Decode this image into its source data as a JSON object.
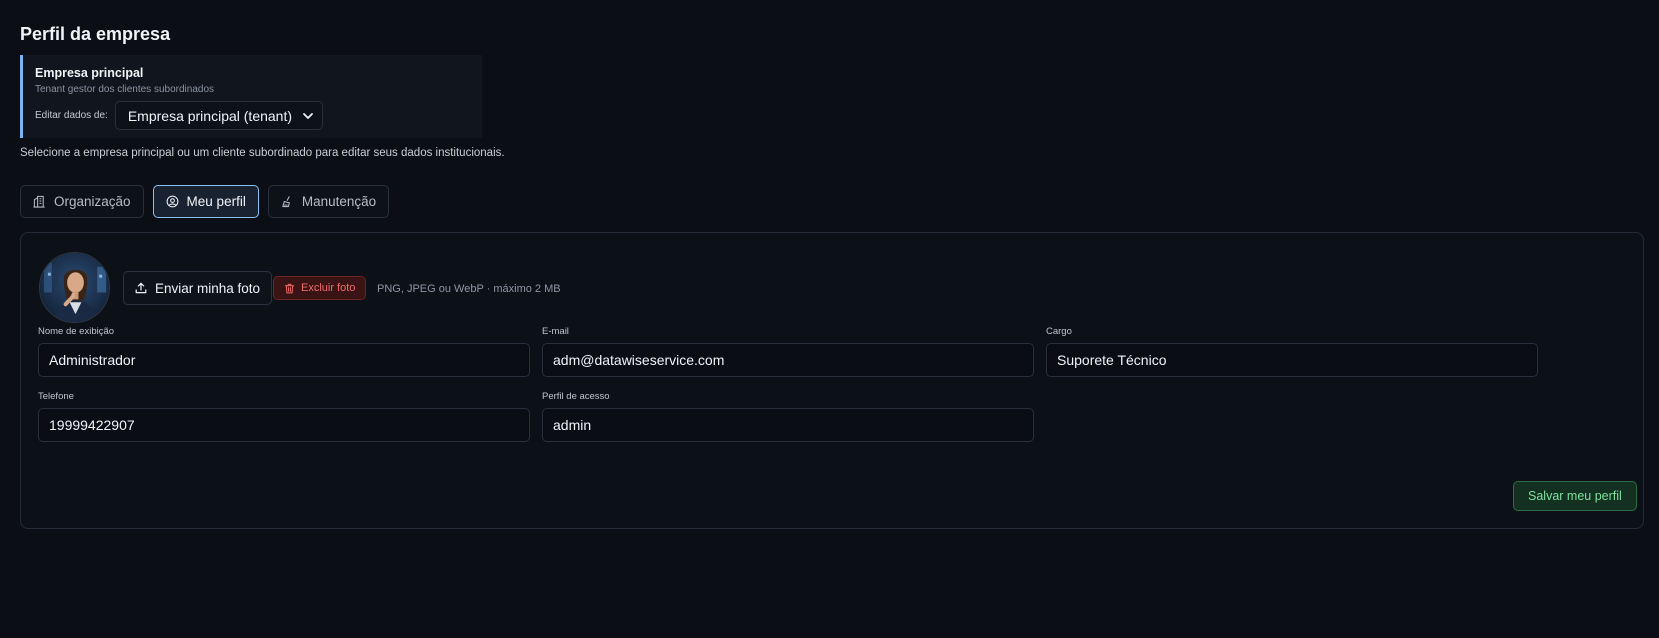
{
  "page": {
    "title": "Perfil da empresa",
    "helper_text": "Selecione a empresa principal ou um cliente subordinado para editar seus dados institucionais."
  },
  "tenant": {
    "name": "Empresa principal",
    "subtitle": "Tenant gestor dos clientes subordinados",
    "edit_label": "Editar dados de:",
    "selected_option": "Empresa principal (tenant)"
  },
  "tabs": [
    {
      "label": "Organização",
      "icon": "building-icon",
      "active": false
    },
    {
      "label": "Meu perfil",
      "icon": "user-circle-icon",
      "active": true
    },
    {
      "label": "Manutenção",
      "icon": "broom-icon",
      "active": false
    }
  ],
  "profile": {
    "upload_label": "Enviar minha foto",
    "delete_label": "Excluir foto",
    "photo_hint": "PNG, JPEG ou WebP · máximo 2 MB",
    "fields": {
      "display_name": {
        "label": "Nome de exibição",
        "value": "Administrador"
      },
      "email": {
        "label": "E-mail",
        "value": "adm@datawiseservice.com"
      },
      "role": {
        "label": "Cargo",
        "value": "Suporete Técnico"
      },
      "phone": {
        "label": "Telefone",
        "value": "19999422907"
      },
      "access_profile": {
        "label": "Perfil de acesso",
        "value": "admin"
      }
    },
    "save_label": "Salvar meu perfil"
  },
  "colors": {
    "background": "#0b0e14",
    "accent_blue": "#8ec0f5",
    "danger": "#ef6b6b",
    "success": "#7ee0a0"
  }
}
